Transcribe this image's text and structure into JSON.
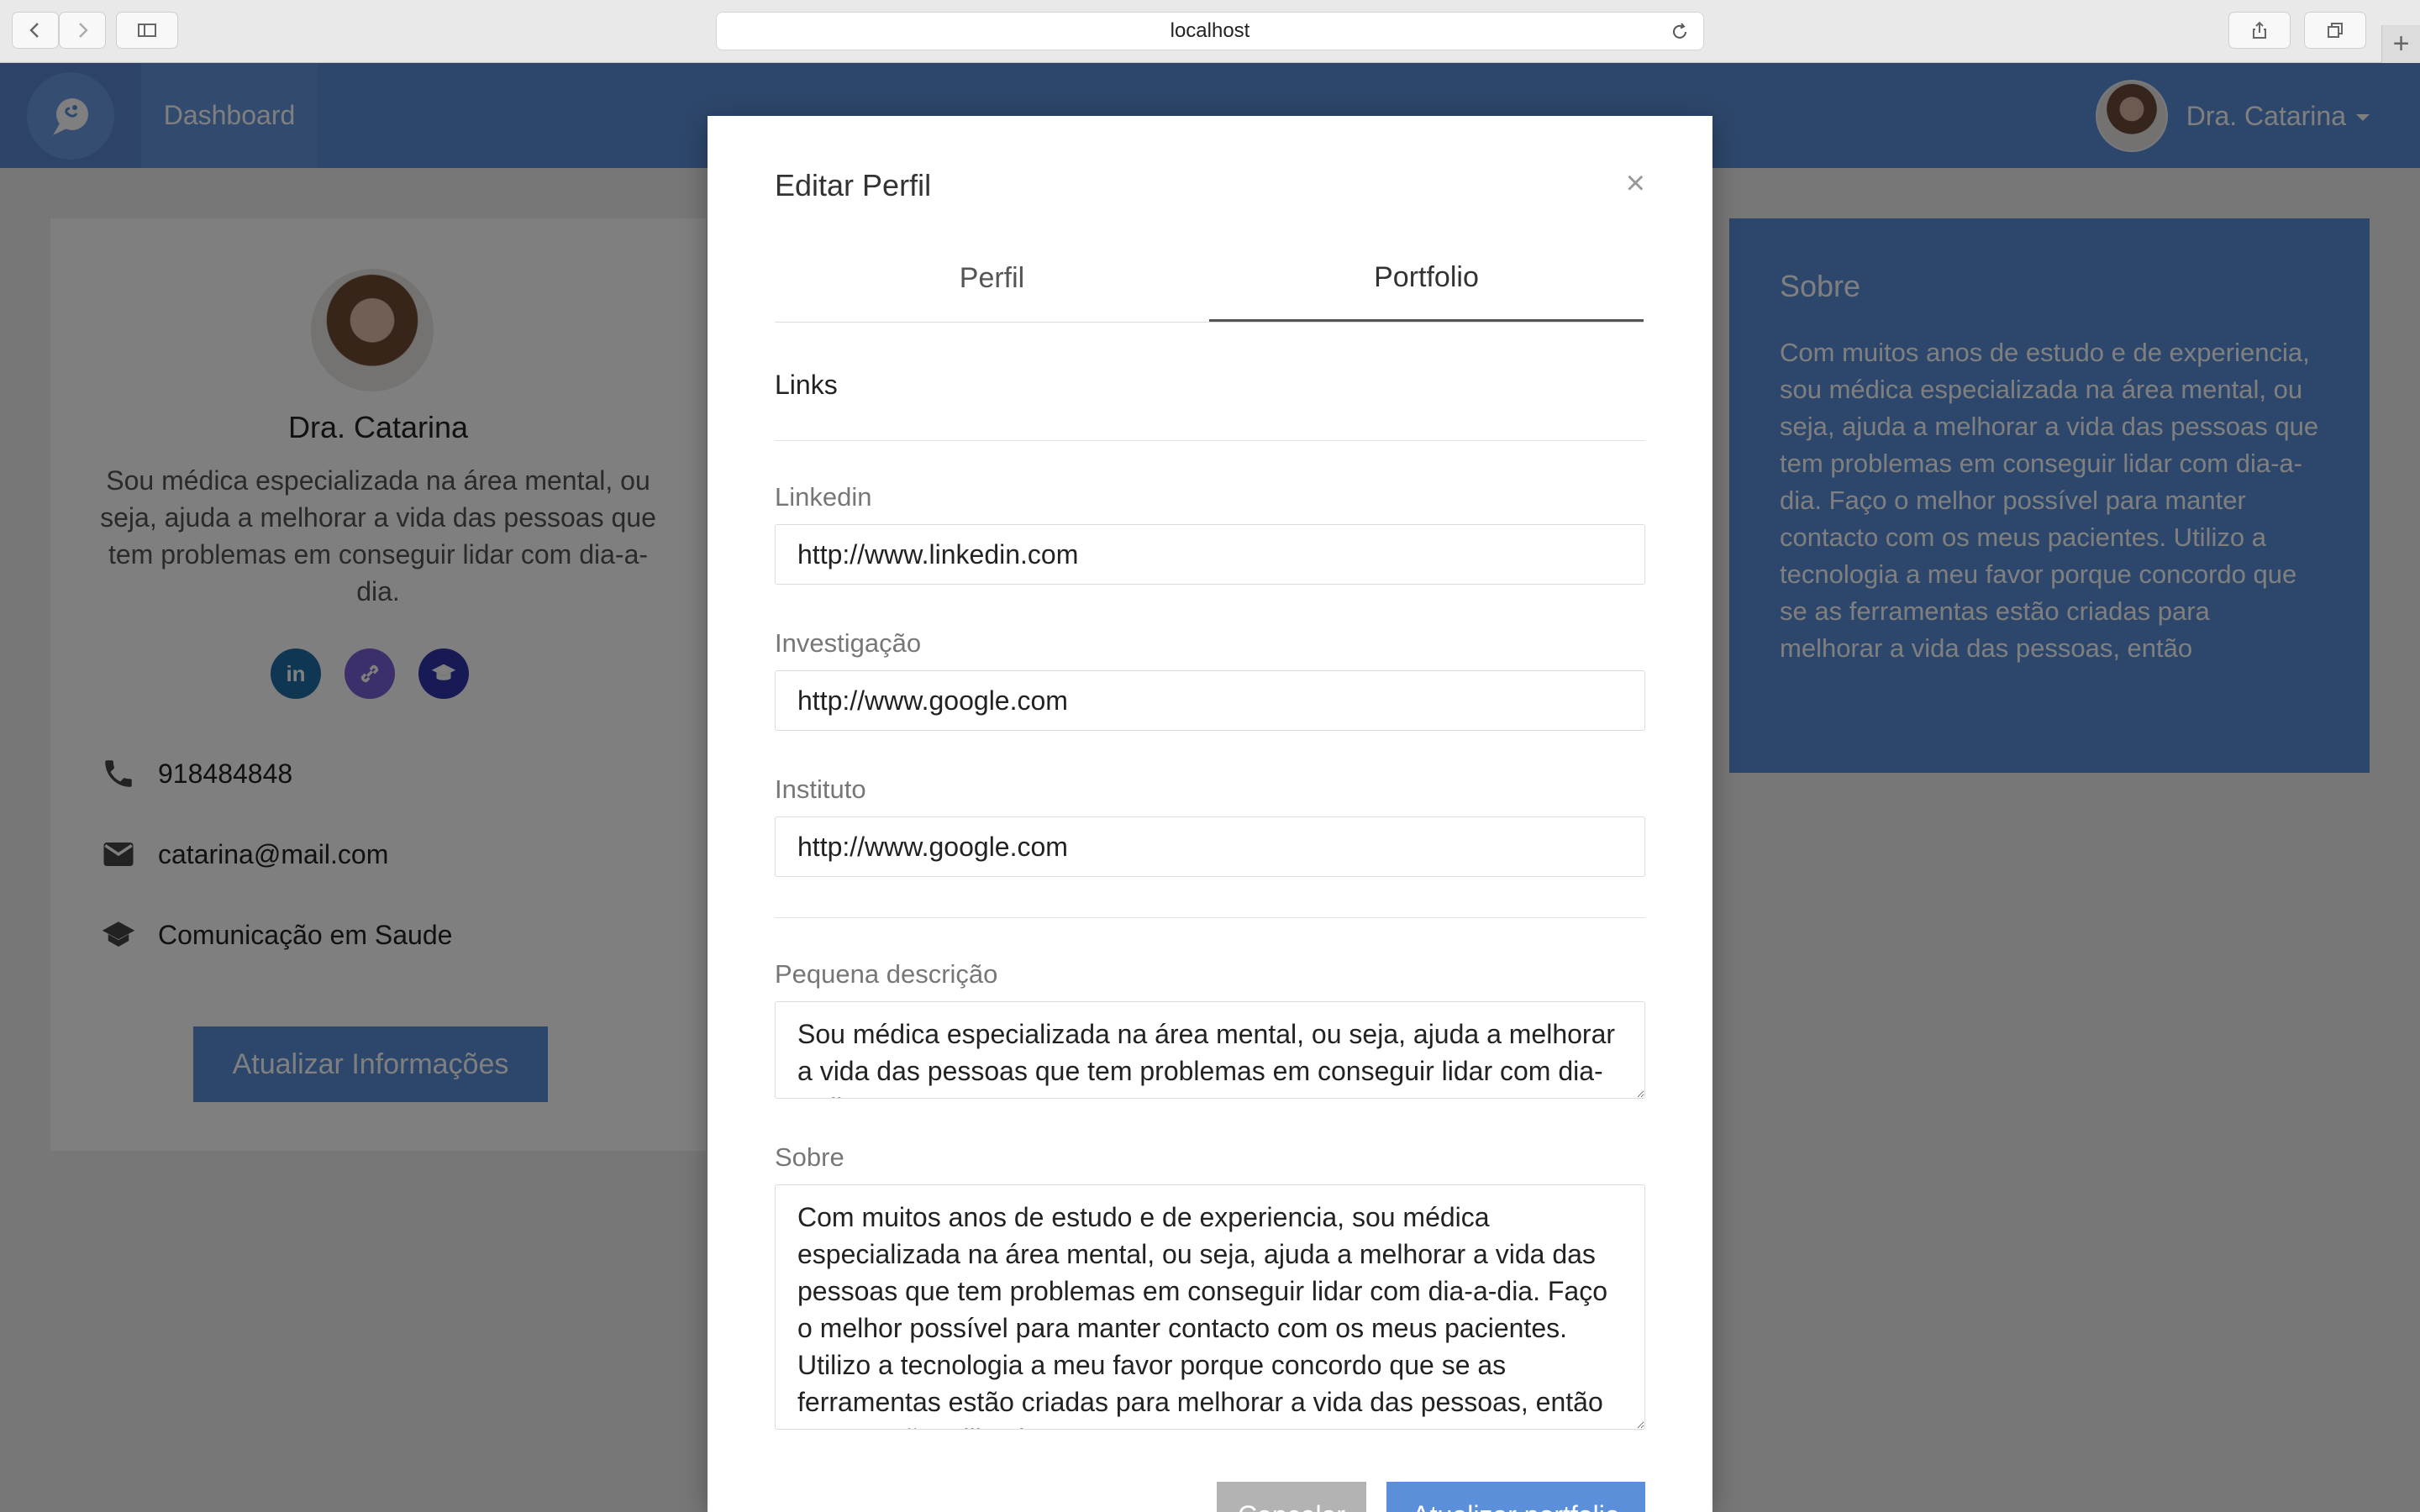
{
  "browser": {
    "url": "localhost",
    "new_tab_symbol": "+",
    "icons": [
      "back-icon",
      "forward-icon",
      "sidebar-icon",
      "reload-icon",
      "share-icon",
      "tabs-icon"
    ]
  },
  "navbar": {
    "dashboard_label": "Dashboard",
    "user_name": "Dra. Catarina"
  },
  "profile": {
    "name": "Dra. Catarina",
    "description": "Sou médica especializada na área mental, ou seja, ajuda a melhorar a vida das pessoas que tem problemas em conseguir lidar com dia-a-dia.",
    "social": {
      "linkedin": "in"
    },
    "phone": "918484848",
    "email": "catarina@mail.com",
    "institution": "Comunicação em Saude",
    "update_button": "Atualizar Informações"
  },
  "about_card": {
    "title": "Sobre",
    "text": "Com muitos anos de estudo e de experiencia, sou médica especializada na área mental, ou seja, ajuda a melhorar a vida das pessoas que tem problemas em conseguir lidar com dia-a-dia. Faço o melhor possível para manter contacto com os meus pacientes. Utilizo a tecnologia a meu favor porque concordo que se as ferramentas estão criadas para melhorar a vida das pessoas, então"
  },
  "modal": {
    "title": "Editar Perfil",
    "close": "×",
    "tabs": [
      {
        "label": "Perfil",
        "active": false
      },
      {
        "label": "Portfolio",
        "active": true
      }
    ],
    "section_title": "Links",
    "fields": {
      "linkedin": {
        "label": "Linkedin",
        "value": "http://www.linkedin.com"
      },
      "investigacao": {
        "label": "Investigação",
        "value": "http://www.google.com"
      },
      "instituto": {
        "label": "Instituto",
        "value": "http://www.google.com"
      },
      "pequena_descricao": {
        "label": "Pequena descrição",
        "value": "Sou médica especializada na área mental, ou seja, ajuda a melhorar a vida das pessoas que tem problemas em conseguir lidar com dia-a-dia."
      },
      "sobre": {
        "label": "Sobre",
        "value": "Com muitos anos de estudo e de experiencia, sou médica especializada na área mental, ou seja, ajuda a melhorar a vida das pessoas que tem problemas em conseguir lidar com dia-a-dia. Faço o melhor possível para manter contacto com os meus pacientes. Utilizo a tecnologia a meu favor porque concordo que se as ferramentas estão criadas para melhorar a vida das pessoas, então porque não utiliza-las"
      }
    },
    "cancel_button": "Cancelar",
    "save_button": "Atualizar portfolio"
  },
  "colors": {
    "brand_blue": "#5b8fd9",
    "linkedin": "#1e6fa8",
    "link": "#7b5fd6",
    "education": "#2f34a8"
  }
}
